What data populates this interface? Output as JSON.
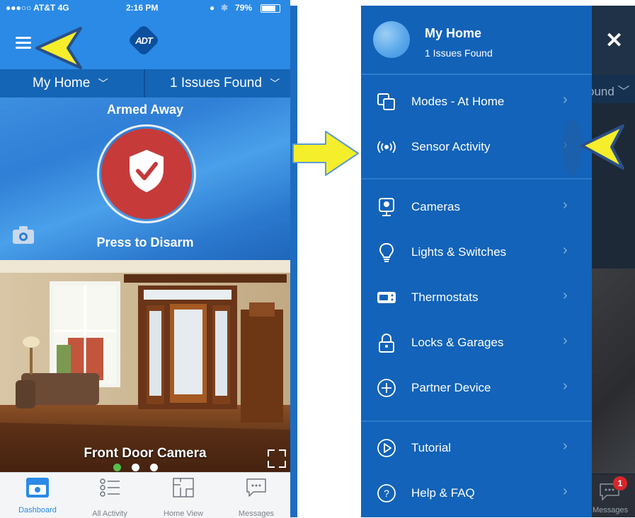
{
  "left_screen": {
    "status_bar": {
      "carrier": "●●●○○ AT&T  4G",
      "time": "2:16 PM",
      "battery": "79%"
    },
    "brand": "ADT",
    "location_selector": "My Home",
    "issues_selector": "1 Issues Found",
    "arm_status": "Armed Away",
    "disarm_label": "Press to Disarm",
    "camera_title": "Front Door Camera",
    "carousel": {
      "page_count": 3,
      "active_index": 0
    },
    "tabs": [
      {
        "label": "Dashboard",
        "icon": "dashboard-icon",
        "active": true
      },
      {
        "label": "All Activity",
        "icon": "activity-list-icon",
        "active": false
      },
      {
        "label": "Home View",
        "icon": "floorplan-icon",
        "active": false
      },
      {
        "label": "Messages",
        "icon": "chat-bubble-icon",
        "active": false
      }
    ]
  },
  "drawer": {
    "title": "My Home",
    "subtitle": "1 Issues Found",
    "close_glyph": "✕",
    "sections": [
      [
        {
          "label": "Modes - At Home",
          "icon": "modes-icon"
        },
        {
          "label": "Sensor Activity",
          "icon": "sensor-waves-icon"
        }
      ],
      [
        {
          "label": "Cameras",
          "icon": "camera-icon"
        },
        {
          "label": "Lights & Switches",
          "icon": "lightbulb-icon"
        },
        {
          "label": "Thermostats",
          "icon": "thermostat-icon"
        },
        {
          "label": "Locks & Garages",
          "icon": "lock-icon"
        },
        {
          "label": "Partner Device",
          "icon": "plus-circle-icon"
        }
      ],
      [
        {
          "label": "Tutorial",
          "icon": "play-circle-icon"
        },
        {
          "label": "Help & FAQ",
          "icon": "question-circle-icon"
        }
      ]
    ],
    "background_peek": {
      "issues_fragment": "ound",
      "messages_label": "Messages",
      "badge_count": "1"
    }
  },
  "colors": {
    "brand_blue": "#2a8ae6",
    "drawer_blue": "#1263b9",
    "disarm_red": "#c63a3a",
    "callout_yellow": "#f5ee2a"
  }
}
